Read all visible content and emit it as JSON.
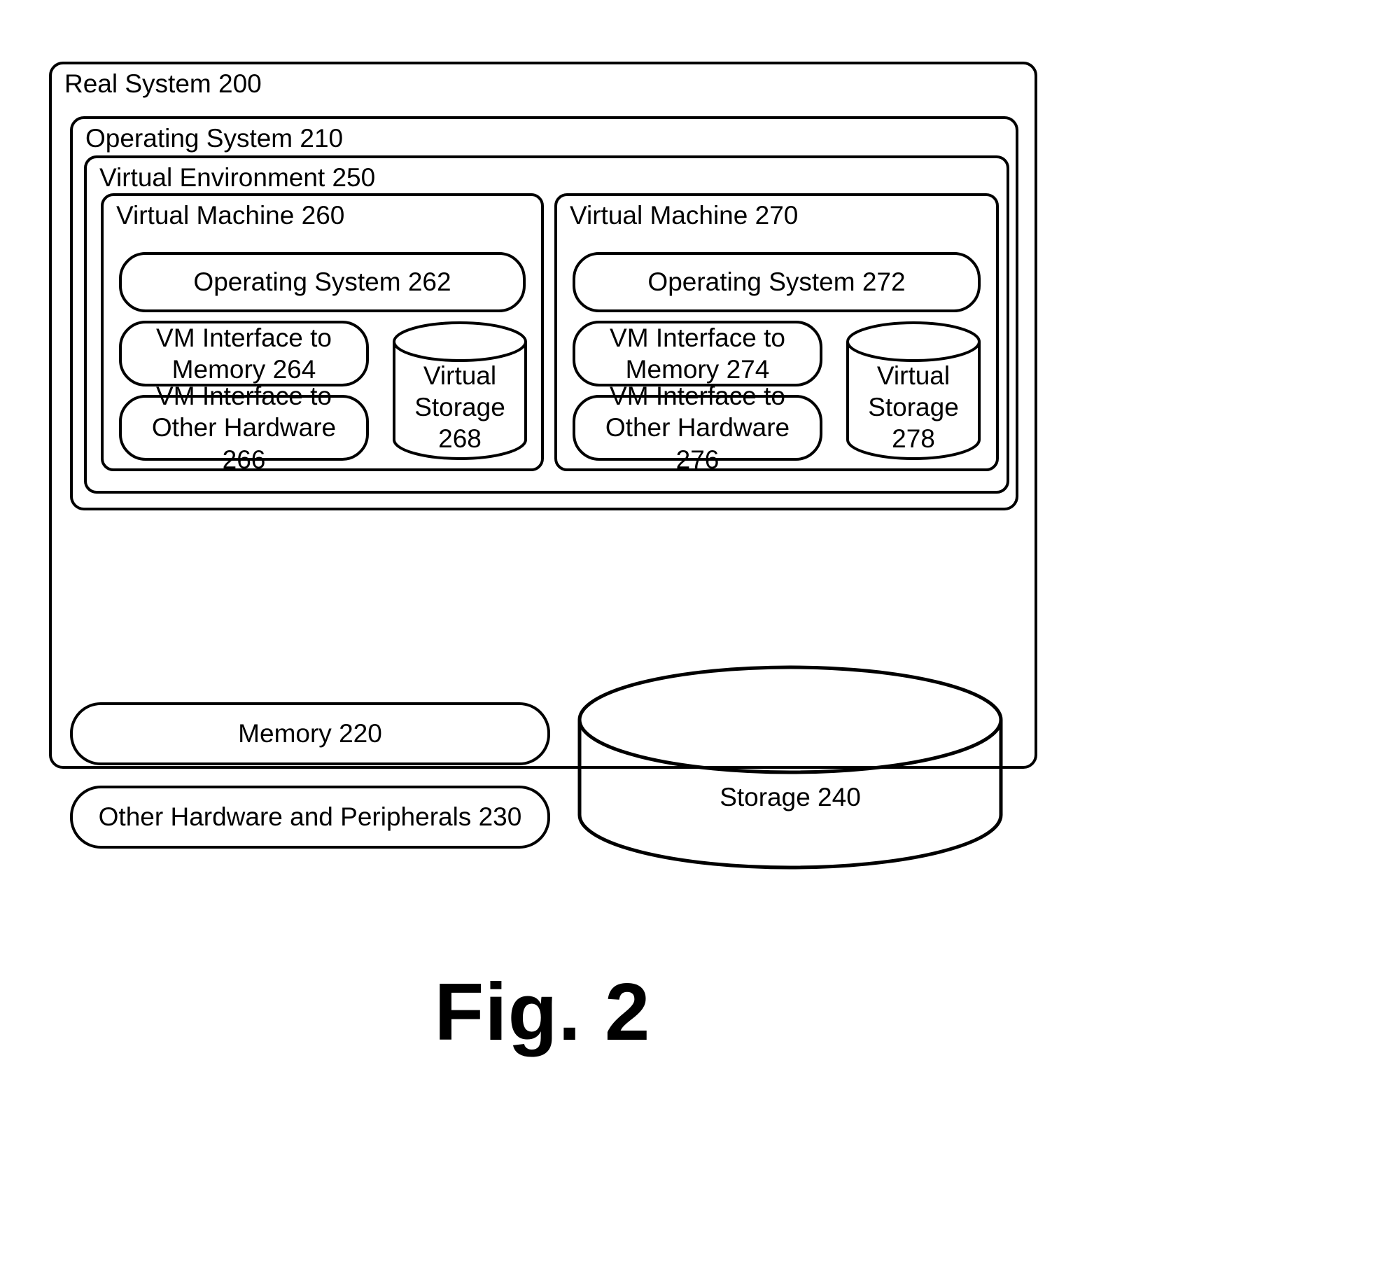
{
  "figure": {
    "caption": "Fig. 2"
  },
  "real_system": {
    "title": "Real System 200",
    "operating_system": {
      "title": "Operating System 210",
      "virtual_environment": {
        "title": "Virtual Environment 250",
        "virtual_machines": [
          {
            "title": "Virtual Machine 260",
            "os": "Operating System 262",
            "iface_memory": "VM Interface to Memory 264",
            "iface_other_hardware": "VM Interface to Other Hardware 266",
            "virtual_storage": "Virtual Storage 268"
          },
          {
            "title": "Virtual Machine 270",
            "os": "Operating System 272",
            "iface_memory": "VM Interface to Memory 274",
            "iface_other_hardware": "VM Interface to Other Hardware 276",
            "virtual_storage": "Virtual Storage 278"
          }
        ]
      }
    },
    "hardware": {
      "memory": "Memory 220",
      "other_hardware": "Other Hardware and Peripherals 230",
      "storage": "Storage 240"
    }
  },
  "colors": {
    "stroke": "#000000",
    "background": "#ffffff"
  }
}
